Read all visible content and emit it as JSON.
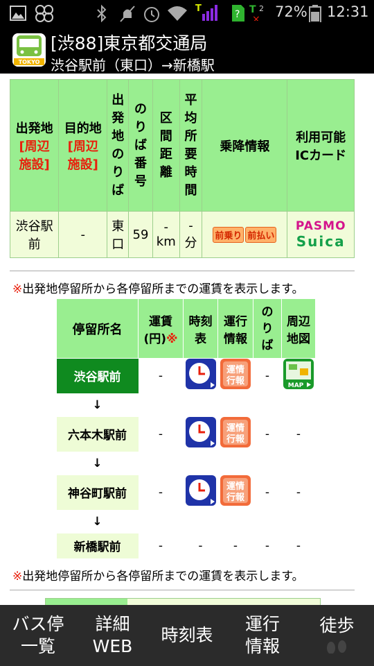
{
  "status_bar": {
    "battery_pct": "72%",
    "time": "12:31",
    "icons": [
      "image-icon",
      "pinwheel-icon",
      "bluetooth-icon",
      "mute-icon",
      "alarm-icon",
      "wifi-icon",
      "signal-icon",
      "sim-unknown-icon",
      "roaming-signal-icon",
      "battery-icon"
    ]
  },
  "header": {
    "title": "[渋88]東京都交通局",
    "subtitle": "渋谷駅前（東口）→新橋駅",
    "app_icon_label": "TOKYO"
  },
  "route_table": {
    "headers": {
      "departure": "出発地",
      "departure_link": "[周辺",
      "departure_link2": "施設]",
      "destination": "目的地",
      "destination_link": "[周辺",
      "destination_link2": "施設]",
      "departure_stop": [
        "出",
        "発",
        "地",
        "の",
        "り",
        "ば"
      ],
      "platform_no": [
        "の",
        "り",
        "ば",
        "番",
        "号"
      ],
      "distance": [
        "区",
        "間",
        "距",
        "離"
      ],
      "avg_time": [
        "平",
        "均",
        "所",
        "要",
        "時",
        "間"
      ],
      "boarding_info": "乗降情報",
      "ic_cards": "利用可能",
      "ic_cards2": "ICカード"
    },
    "row": {
      "departure": "渋谷駅",
      "departure2": "前",
      "destination": "-",
      "departure_stop": "東",
      "departure_stop2": "口",
      "platform_no": "59",
      "distance": "-",
      "distance_unit": "km",
      "avg_time": "-",
      "avg_time_unit": "分",
      "boarding_tag1": "前乗り",
      "boarding_tag2": "前払い",
      "ic_card1": "PASMO",
      "ic_card2": "Suica"
    }
  },
  "fare_note": {
    "mark": "※",
    "text": "出発地停留所から各停留所までの運賃を表示します。"
  },
  "stops_table": {
    "headers": {
      "stop_name": "停留所名",
      "fare": "運賃",
      "fare2": "(円)",
      "fare_mark": "※",
      "timetable": "時刻",
      "timetable2": "表",
      "operation": "運行",
      "operation2": "情報",
      "platform": [
        "の",
        "り",
        "ば"
      ],
      "map": "周辺",
      "map2": "地図"
    },
    "stops": [
      {
        "name": "渋谷駅前",
        "fare": "-",
        "platform": "-",
        "map": "MAP",
        "current": true
      },
      {
        "name": "六本木駅前",
        "fare": "-",
        "platform": "-",
        "map": "-"
      },
      {
        "name": "神谷町駅前",
        "fare": "-",
        "platform": "-",
        "map": "-"
      },
      {
        "name": "新橋駅前",
        "fare": "-",
        "timetable": "-",
        "operation": "-",
        "platform": "-",
        "map": "-"
      }
    ],
    "arrow": "↓",
    "op_icon_text": "運行情報"
  },
  "bottom_nav": {
    "items": [
      {
        "label1": "バス停",
        "label2": "一覧"
      },
      {
        "label1": "詳細",
        "label2": "WEB"
      },
      {
        "label1": "時刻表",
        "label2": ""
      },
      {
        "label1": "運行",
        "label2": "情報"
      },
      {
        "label1": "徒歩",
        "label2": ""
      }
    ]
  },
  "colors": {
    "header_green": "#99ee90",
    "row_green": "#f1fcd9",
    "current_stop": "#0f8a1f",
    "red": "#e8200c",
    "nav_bg": "#2b2b2b"
  }
}
